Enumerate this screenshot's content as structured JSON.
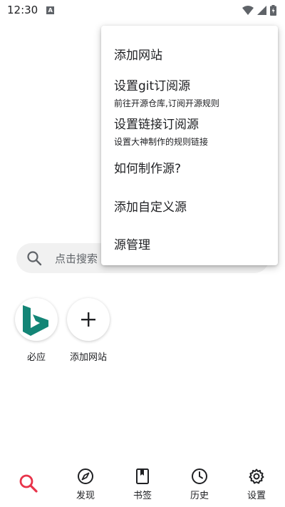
{
  "status_bar": {
    "time": "12:30",
    "notification_icon": "a-icon"
  },
  "search": {
    "placeholder": "点击搜索"
  },
  "shortcuts": [
    {
      "label": "必应",
      "icon": "bing-icon"
    },
    {
      "label": "添加网站",
      "icon": "plus-icon"
    }
  ],
  "menu": {
    "items": [
      {
        "title": "添加网站",
        "subtitle": ""
      },
      {
        "title": "设置git订阅源",
        "subtitle": "前往开源仓库,订阅开源规则"
      },
      {
        "title": "设置链接订阅源",
        "subtitle": "设置大神制作的规则链接"
      },
      {
        "title": "如何制作源?",
        "subtitle": ""
      },
      {
        "title": "添加自定义源",
        "subtitle": ""
      },
      {
        "title": "源管理",
        "subtitle": ""
      }
    ]
  },
  "bottom_nav": {
    "items": [
      {
        "label": "",
        "icon": "search-icon",
        "active": true
      },
      {
        "label": "发现",
        "icon": "compass-icon"
      },
      {
        "label": "书签",
        "icon": "bookmark-icon"
      },
      {
        "label": "历史",
        "icon": "clock-icon"
      },
      {
        "label": "设置",
        "icon": "gear-icon"
      }
    ],
    "active_color": "#e8334a"
  },
  "colors": {
    "bing_teal": "#138576",
    "search_bar_bg": "#f1f1f1"
  }
}
